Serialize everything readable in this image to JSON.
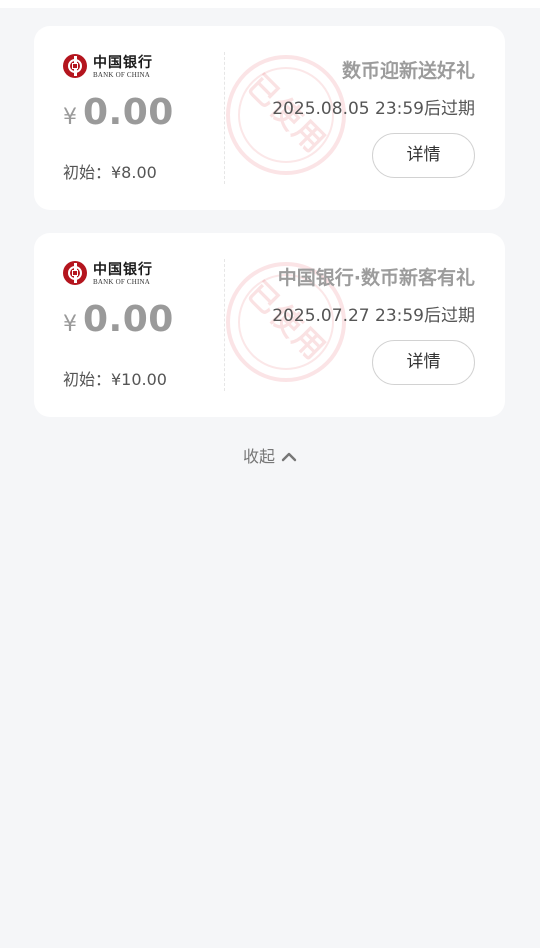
{
  "coupons": [
    {
      "bank_logo": {
        "cn": "中国银行",
        "en": "BANK OF CHINA",
        "color": "#b4151e"
      },
      "currency": "¥",
      "amount": "0.00",
      "initial": "初始：¥8.00",
      "title": "数币迎新送好礼",
      "expire": "2025.08.05 23:59后过期",
      "stamp": "已使用",
      "detail_label": "详情"
    },
    {
      "bank_logo": {
        "cn": "中国银行",
        "en": "BANK OF CHINA",
        "color": "#b4151e"
      },
      "currency": "¥",
      "amount": "0.00",
      "initial": "初始：¥10.00",
      "title": "中国银行·数币新客有礼",
      "expire": "2025.07.27 23:59后过期",
      "stamp": "已使用",
      "detail_label": "详情"
    }
  ],
  "collapse_label": "收起",
  "colors": {
    "background": "#f5f6f8",
    "card": "#ffffff",
    "stamp": "#e76c73",
    "muted_text": "#9c9c9c"
  }
}
